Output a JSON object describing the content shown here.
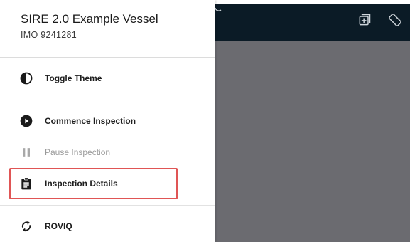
{
  "drawer": {
    "vessel_name": "SIRE 2.0 Example Vessel",
    "imo": "IMO 9241281",
    "items": [
      {
        "label": "Toggle Theme",
        "icon": "contrast-icon",
        "disabled": false
      },
      {
        "label": "Commence Inspection",
        "icon": "play-circle-icon",
        "disabled": false
      },
      {
        "label": "Pause Inspection",
        "icon": "pause-icon",
        "disabled": true
      },
      {
        "label": "Inspection Details",
        "icon": "clipboard-icon",
        "disabled": false,
        "highlighted": true
      },
      {
        "label": "ROVIQ",
        "icon": "sync-icon",
        "disabled": false
      }
    ]
  },
  "topbar": {
    "icons": [
      "add-box-icon",
      "screen-rotation-icon"
    ]
  },
  "colors": {
    "topbar": "#0b1b26",
    "overlay": "#6b6b70",
    "highlight": "#e05555",
    "disabled_text": "#9a9a9a"
  }
}
